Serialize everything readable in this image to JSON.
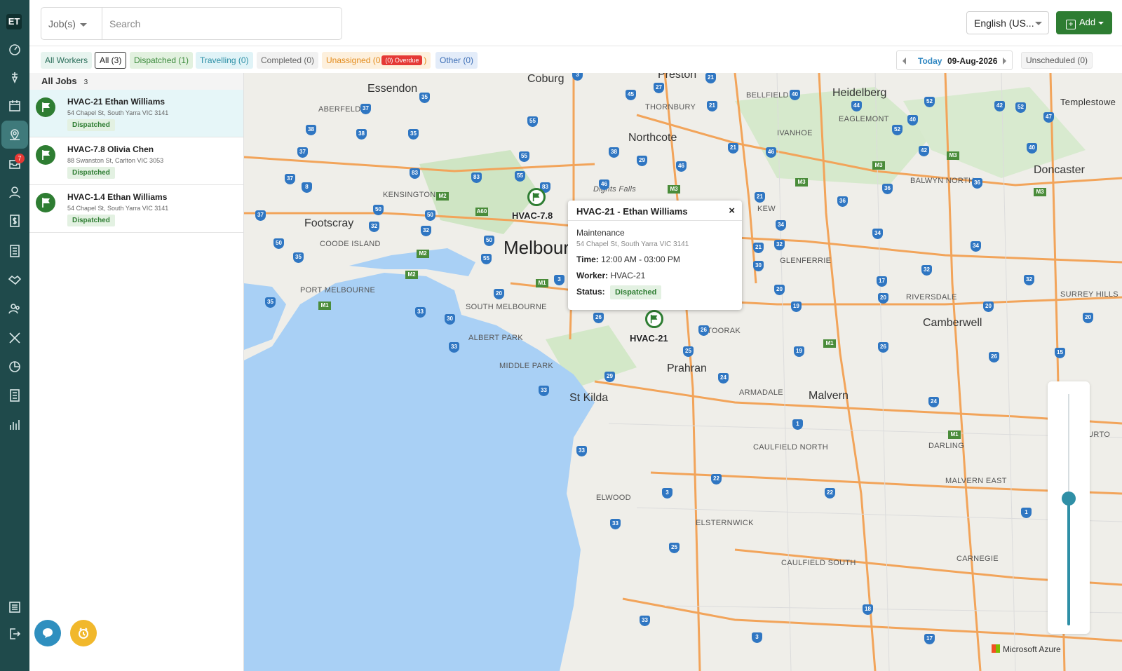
{
  "app": {
    "logo": "ET"
  },
  "sidebar": {
    "items": [
      {
        "icon": "dashboard-icon"
      },
      {
        "icon": "dispatch-icon"
      },
      {
        "icon": "calendar-icon"
      },
      {
        "icon": "map-pin-icon",
        "active": true
      },
      {
        "icon": "inbox-icon",
        "badge": "7"
      },
      {
        "icon": "user-icon"
      },
      {
        "icon": "dollar-icon"
      },
      {
        "icon": "list-icon"
      },
      {
        "icon": "handshake-icon"
      },
      {
        "icon": "team-icon"
      },
      {
        "icon": "tools-icon"
      },
      {
        "icon": "chart-pie-icon"
      },
      {
        "icon": "calculator-icon"
      },
      {
        "icon": "bar-chart-icon"
      },
      {
        "icon": "settings-sliders-icon"
      },
      {
        "icon": "logout-icon"
      }
    ]
  },
  "header": {
    "jobs_select": "Job(s)",
    "search_placeholder": "Search",
    "language": "English (US...",
    "add_label": "Add"
  },
  "filters": {
    "all_workers": "All Workers",
    "all": "All (3)",
    "dispatched": "Dispatched (1)",
    "travelling": "Travelling (0)",
    "completed": "Completed (0)",
    "unassigned_prefix": "Unassigned (0",
    "overdue": "(0) Overdue",
    "unassigned_suffix": ")",
    "other": "Other (0)",
    "today": "Today",
    "date": "09-Aug-2026",
    "unscheduled": "Unscheduled (0)"
  },
  "job_list": {
    "header": "All Jobs",
    "count": "3",
    "jobs": [
      {
        "title": "HVAC-21 Ethan Williams",
        "address": "54 Chapel St, South Yarra VIC 3141",
        "status": "Dispatched"
      },
      {
        "title": "HVAC-7.8 Olivia Chen",
        "address": "88 Swanston St, Carlton VIC 3053",
        "status": "Dispatched"
      },
      {
        "title": "HVAC-1.4 Ethan Williams",
        "address": "54 Chapel St, South Yarra VIC 3141",
        "status": "Dispatched"
      }
    ]
  },
  "popup": {
    "title": "HVAC-21 - Ethan Williams",
    "close": "×",
    "type": "Maintenance",
    "address": "54 Chapel St, South Yarra VIC 3141",
    "time_label": "Time:",
    "time_value": "12:00 AM - 03:00 PM",
    "worker_label": "Worker:",
    "worker_value": "HVAC-21",
    "status_label": "Status:",
    "status_value": "Dispatched"
  },
  "map": {
    "marker_labels": [
      "HVAC-7.8",
      "HVAC-21"
    ],
    "attribution": "Microsoft Azure",
    "labels": [
      "Essendon",
      "Coburg",
      "Preston",
      "Heidelberg",
      "Northcote",
      "Footscray",
      "Melbourn",
      "Doncaster",
      "Camberwell",
      "Prahran",
      "St Kilda",
      "Malvern",
      "ELWOOD",
      "PORT MELBOURNE",
      "SOUTH MELBOURNE",
      "ALBERT PARK",
      "MIDDLE PARK",
      "CAULFIELD NORTH",
      "CAULFIELD SOUTH",
      "ELSTERNWICK",
      "CARNEGIE",
      "MALVERN EAST",
      "ARMADALE",
      "TOORAK",
      "KEW",
      "GLENFERRIE",
      "RIVERSDALE",
      "SURREY HILLS",
      "BALWYN NORTH",
      "IVANHOE",
      "THORNBURY",
      "KENSINGTON",
      "ABERFELDIE",
      "COODE ISLAND",
      "DARLING",
      "ASHBURTO",
      "Templestowe",
      "EAGLEMONT",
      "BELLFIELD",
      "Dights Falls"
    ],
    "zoom_level": 0.55
  },
  "colors": {
    "sidebar": "#1f4a4b",
    "accent_green": "#2e7d32",
    "water": "#a9d0f5"
  }
}
